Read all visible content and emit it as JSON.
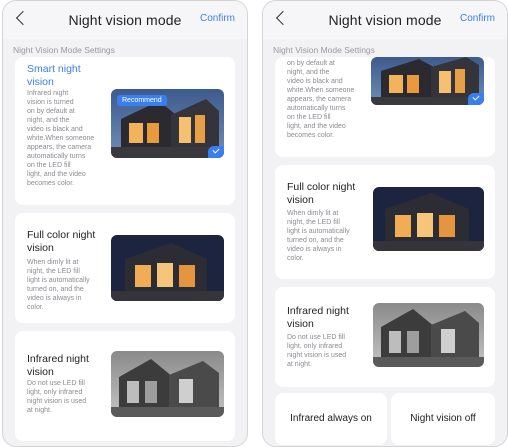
{
  "header": {
    "title": "Night vision mode",
    "confirm_label": "Confirm"
  },
  "section_title": "Night Vision Mode Settings",
  "recommend_badge": "Recommend",
  "modes": {
    "smart": {
      "title": "Smart night\nvision",
      "desc_left": "Infrared night\nvision is turned\non by default at\nnight, and the\nvideo is black and\nwhite.When someone\nappears, the camera\nautomatically turns\non the LED fill\nlight, and the video\nbecomes color.",
      "desc_right": "on by default at\nnight, and the\nvideo is black and\nwhite.When someone\nappears, the camera\nautomatically turns\non the LED fill\nlight, and the video\nbecomes color."
    },
    "full_color": {
      "title": "Full color night\nvision",
      "desc": "When dimly lit at\nnight, the LED fill\nlight is automatically\nturned on, and the\nvideo is always in\ncolor."
    },
    "infrared": {
      "title": "Infrared night\nvision",
      "desc": "Do not use LED fill\nlight, only infrared\nnight vision is used\nat night."
    }
  },
  "buttons": {
    "infrared_always_on": "Infrared always on",
    "night_vision_off": "Night vision off"
  },
  "colors": {
    "accent": "#3a7ff0"
  }
}
